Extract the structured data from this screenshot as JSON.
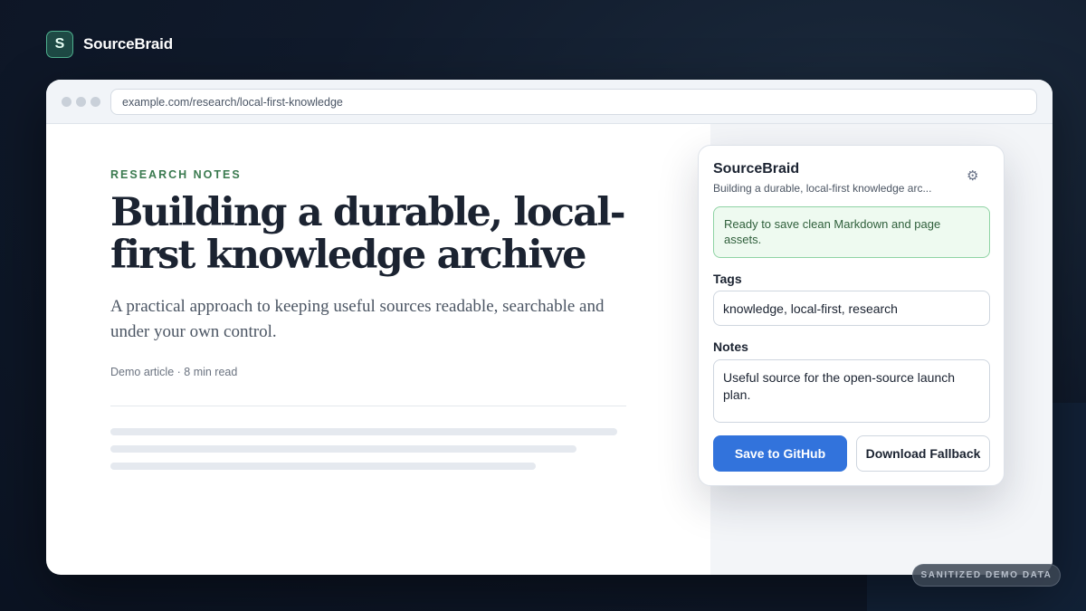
{
  "brand": {
    "logo_letter": "S",
    "name": "SourceBraid"
  },
  "browser": {
    "url": "example.com/research/local-first-knowledge"
  },
  "article": {
    "eyebrow": "RESEARCH NOTES",
    "headline": "Building a durable, local-first knowledge archive",
    "subtitle": "A practical approach to keeping useful sources readable, searchable and under your own control.",
    "meta": "Demo article · 8 min read"
  },
  "popup": {
    "title": "SourceBraid",
    "subtitle": "Building a durable, local-first knowledge arc...",
    "settings_icon": "gear-icon",
    "status": "Ready to save clean Markdown and page assets.",
    "tags_label": "Tags",
    "tags_value": "knowledge, local-first, research",
    "notes_label": "Notes",
    "notes_value": "Useful source for the open-source launch plan.",
    "save_button": "Save to GitHub",
    "download_button": "Download Fallback"
  },
  "badge": "SANITIZED DEMO DATA",
  "colors": {
    "accent": "#3273dc",
    "eyebrow": "#3a7a4f",
    "status_bg": "#eefaf0",
    "status_border": "#8fd3a4",
    "background": "#0b1322"
  }
}
